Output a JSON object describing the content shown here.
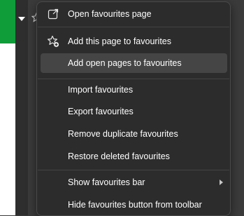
{
  "menu": {
    "items": [
      {
        "label": "Open favourites page",
        "icon": "open-external-icon"
      },
      {
        "label": "Add this page to favourites",
        "icon": "star-add-icon"
      },
      {
        "label": "Add open pages to favourites",
        "highlighted": true
      },
      {
        "label": "Import favourites"
      },
      {
        "label": "Export favourites"
      },
      {
        "label": "Remove duplicate favourites"
      },
      {
        "label": "Restore deleted favourites"
      },
      {
        "label": "Show favourites bar",
        "submenu": true
      },
      {
        "label": "Hide favourites button from toolbar"
      }
    ]
  },
  "colors": {
    "menu_background": "#2c2c2c",
    "highlight": "#454545",
    "text": "#ffffff",
    "page_accent": "#0f9d3a"
  }
}
